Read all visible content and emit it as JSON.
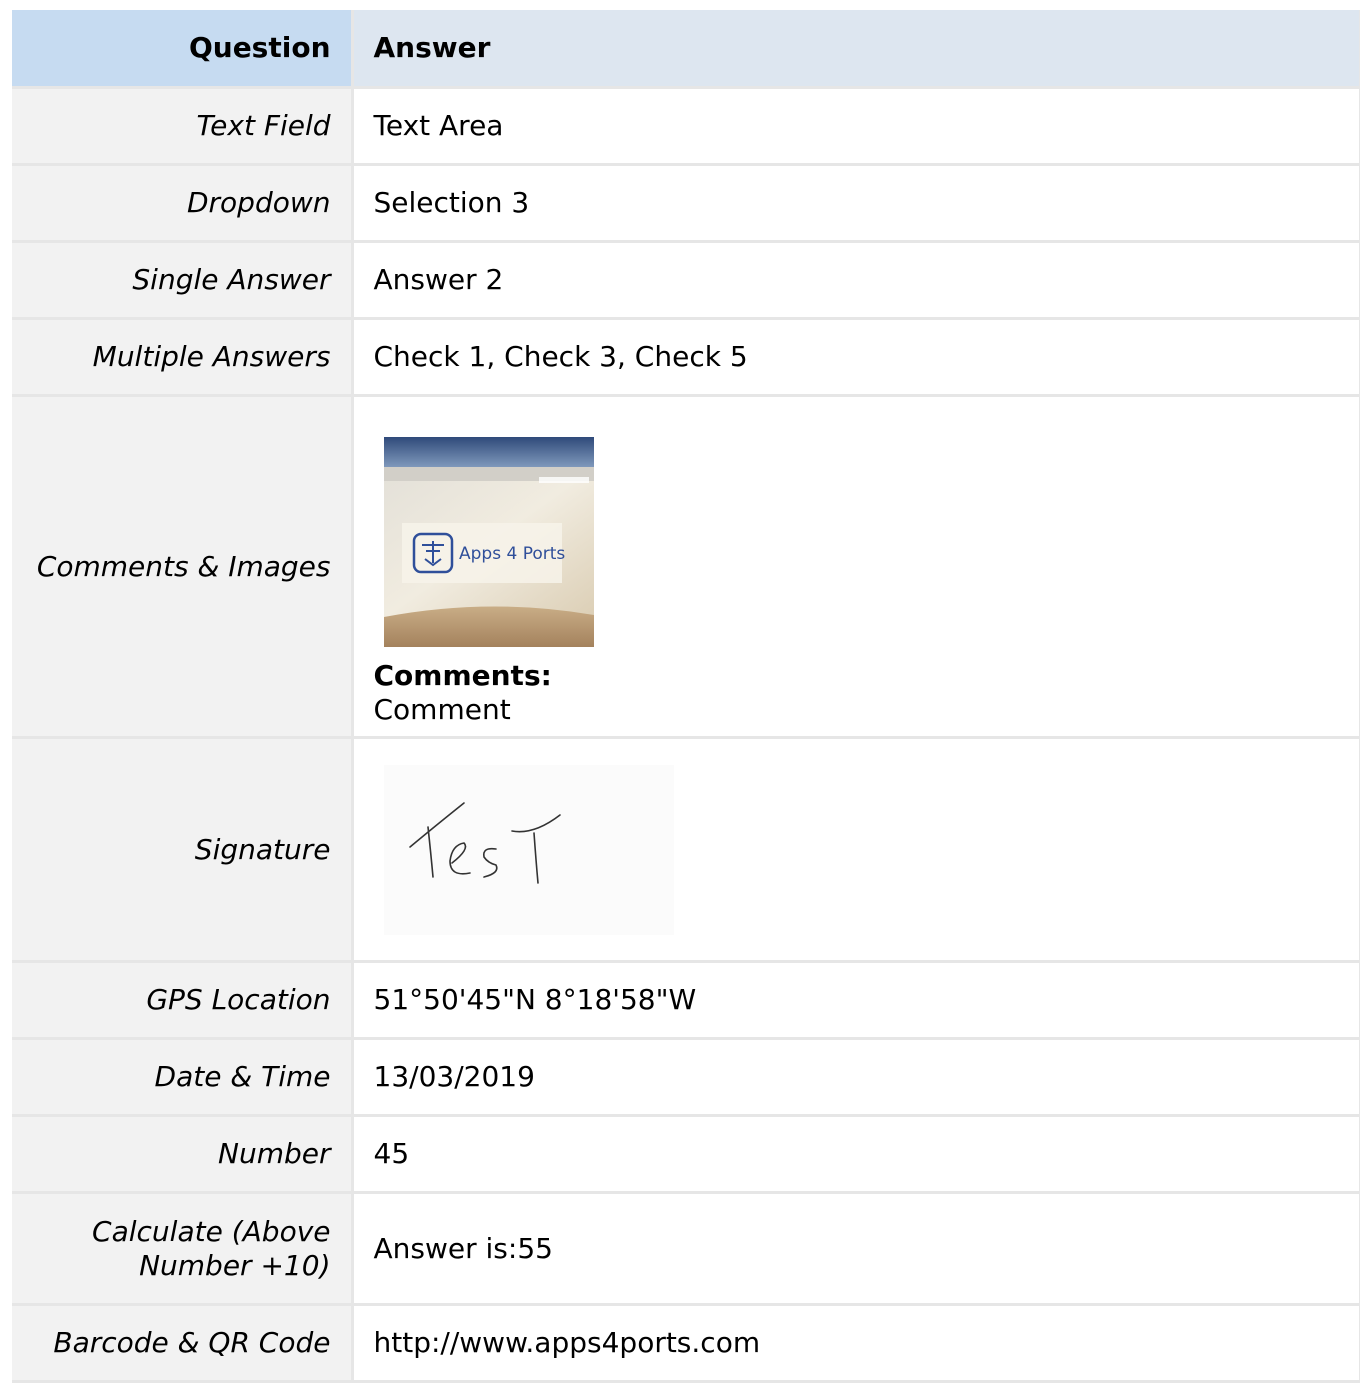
{
  "header": {
    "question": "Question",
    "answer": "Answer"
  },
  "rows": [
    {
      "question": "Text Field",
      "answer": "Text Area"
    },
    {
      "question": "Dropdown",
      "answer": "Selection 3"
    },
    {
      "question": "Single Answer",
      "answer": "Answer 2"
    },
    {
      "question": "Multiple Answers",
      "answer": "Check 1, Check 3, Check 5"
    },
    {
      "question": "Comments & Images",
      "image_text": "Apps 4 Ports",
      "comments_label": "Comments:",
      "comments_value": "Comment"
    },
    {
      "question": "Signature",
      "signature_text": "Test"
    },
    {
      "question": "GPS Location",
      "answer": "51°50'45\"N 8°18'58\"W"
    },
    {
      "question": "Date & Time",
      "answer": "13/03/2019"
    },
    {
      "question": "Number",
      "answer": "45"
    },
    {
      "question": "Calculate (Above Number +10)",
      "answer": "Answer is:55"
    },
    {
      "question": "Barcode & QR Code",
      "answer": "http://www.apps4ports.com"
    }
  ],
  "colors": {
    "header_question_bg": "#c6dbf1",
    "header_answer_bg": "#dde6f0",
    "question_cell_bg": "#f2f2f2",
    "border": "#e6e6e6",
    "logo_blue": "#2f4f9a"
  }
}
